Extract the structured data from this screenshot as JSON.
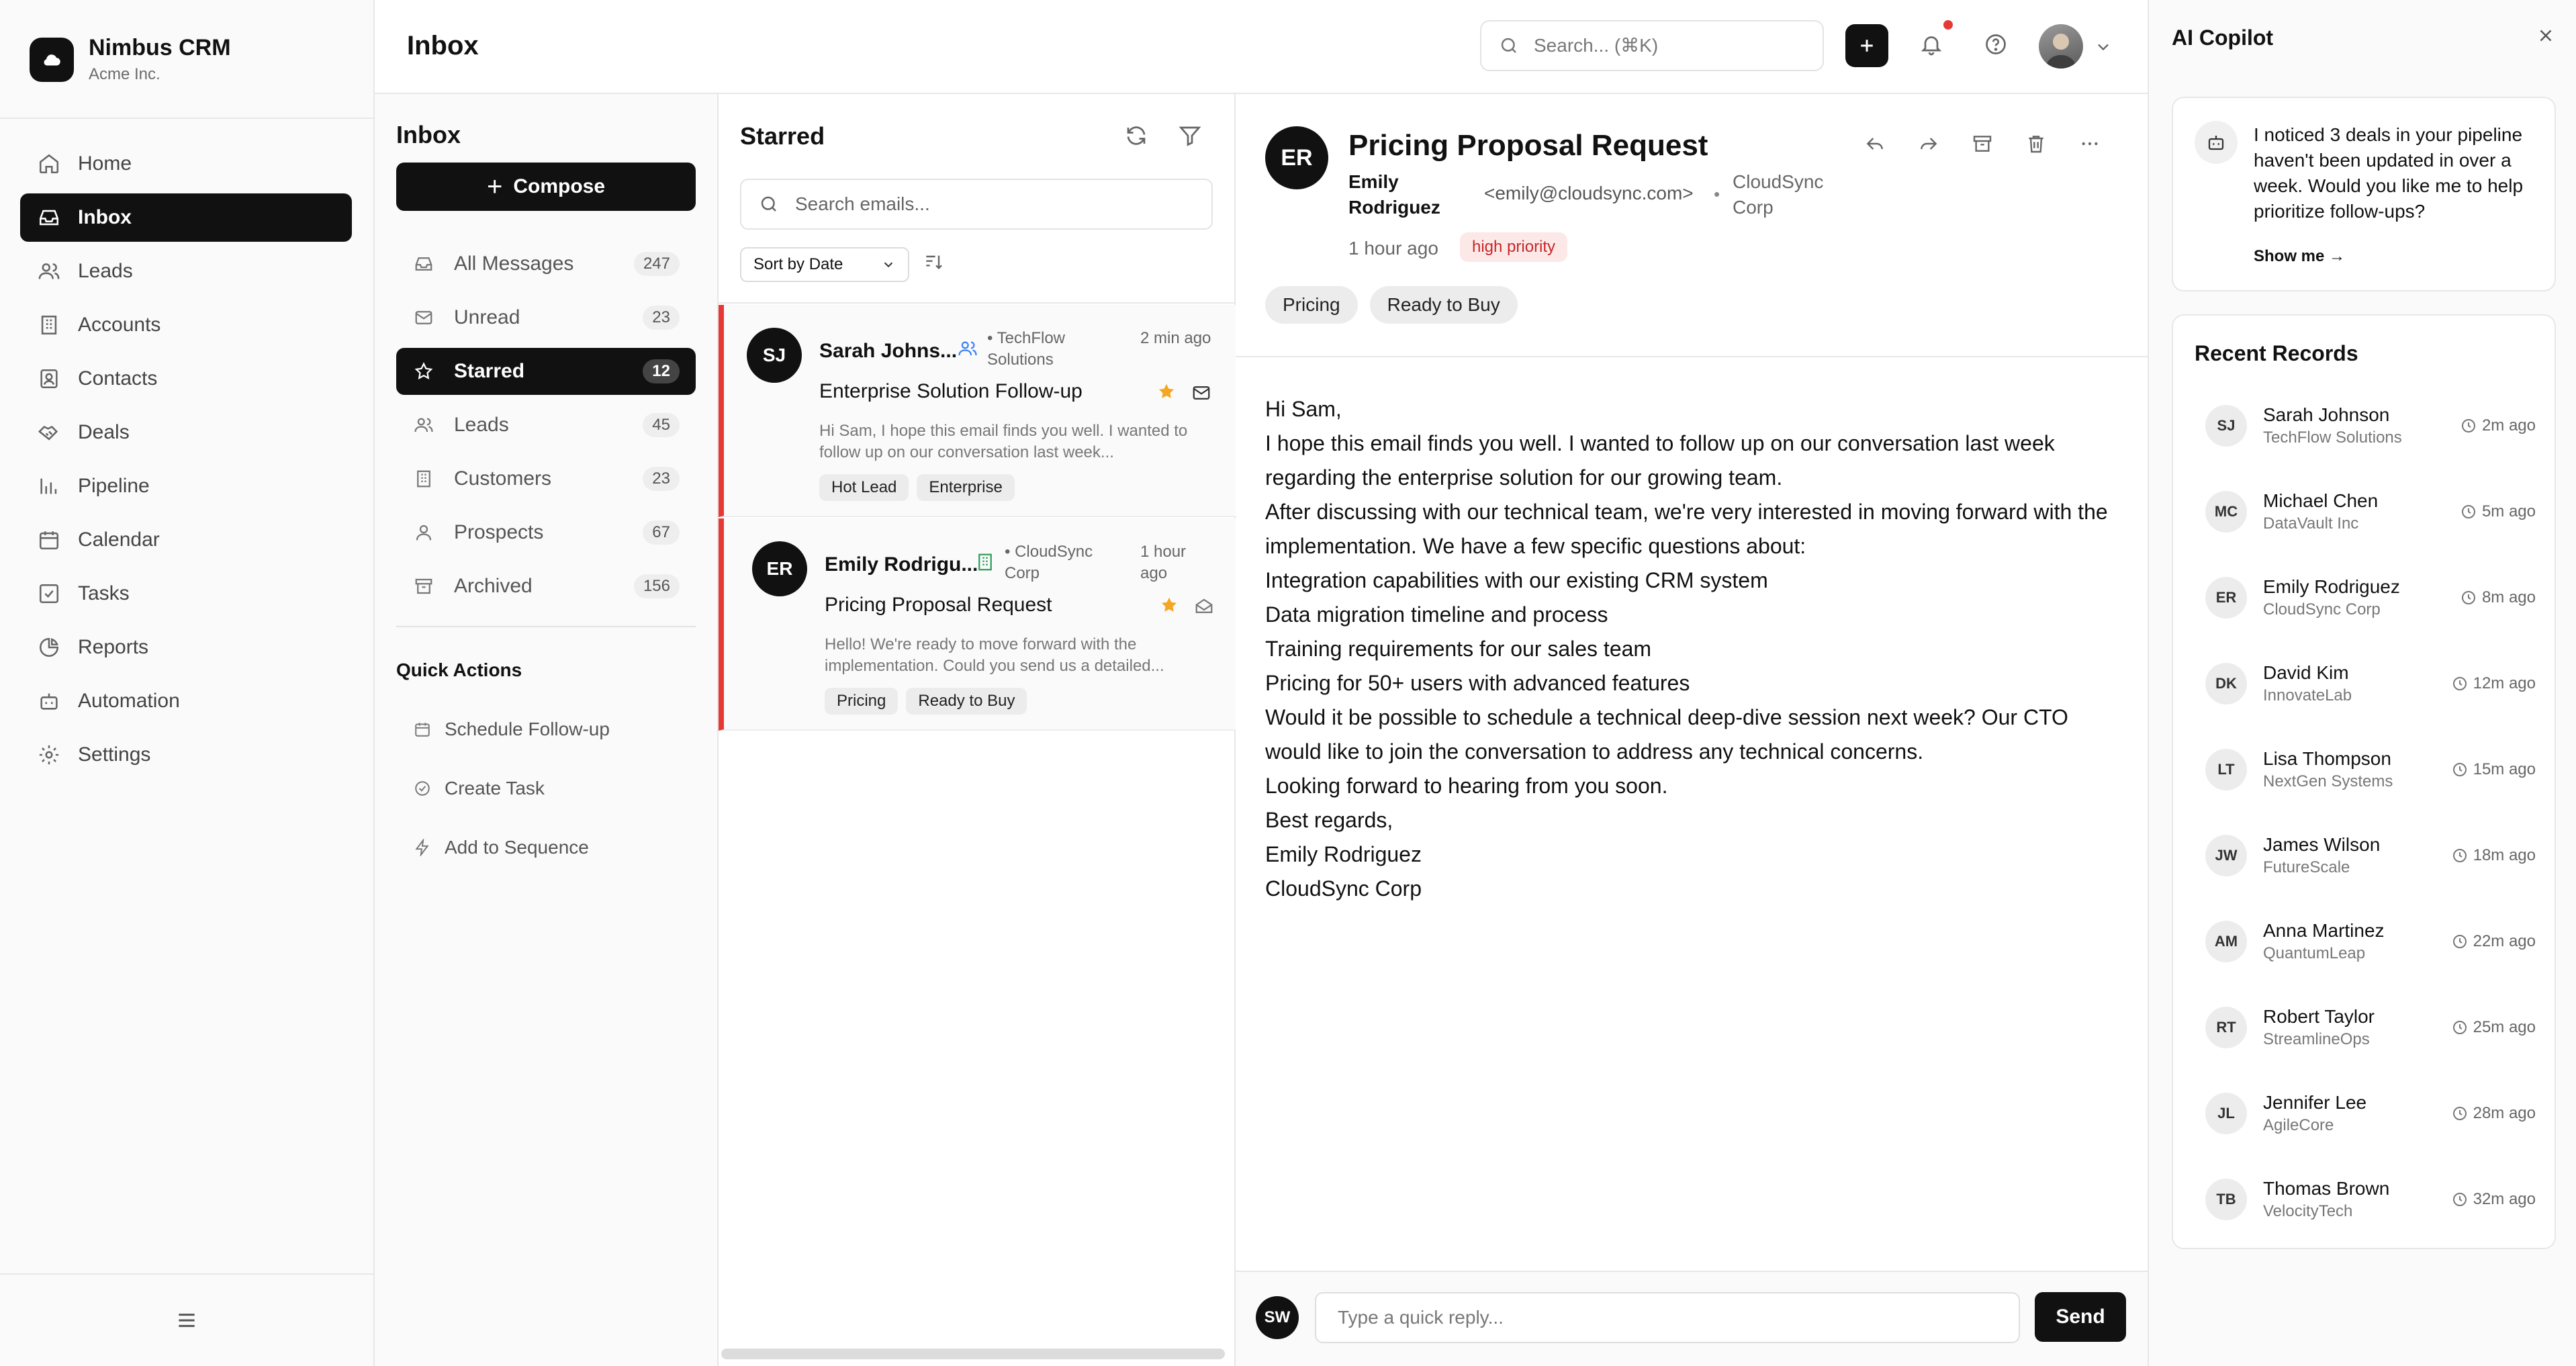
{
  "app": {
    "name": "Nimbus CRM",
    "org": "Acme Inc."
  },
  "nav": {
    "items": [
      {
        "label": "Home",
        "icon": "home-icon"
      },
      {
        "label": "Inbox",
        "icon": "inbox-icon",
        "active": true
      },
      {
        "label": "Leads",
        "icon": "users-icon"
      },
      {
        "label": "Accounts",
        "icon": "building-icon"
      },
      {
        "label": "Contacts",
        "icon": "contacts-icon"
      },
      {
        "label": "Deals",
        "icon": "handshake-icon"
      },
      {
        "label": "Pipeline",
        "icon": "bar-chart-icon"
      },
      {
        "label": "Calendar",
        "icon": "calendar-icon"
      },
      {
        "label": "Tasks",
        "icon": "checkbox-icon"
      },
      {
        "label": "Reports",
        "icon": "pie-chart-icon"
      },
      {
        "label": "Automation",
        "icon": "bot-icon"
      },
      {
        "label": "Settings",
        "icon": "gear-icon"
      }
    ]
  },
  "topbar": {
    "title": "Inbox",
    "search_placeholder": "Search... (⌘K)"
  },
  "folders": {
    "title": "Inbox",
    "compose_label": "Compose",
    "items": [
      {
        "label": "All Messages",
        "count": "247",
        "icon": "inbox-icon"
      },
      {
        "label": "Unread",
        "count": "23",
        "icon": "mail-icon"
      },
      {
        "label": "Starred",
        "count": "12",
        "icon": "star-icon",
        "active": true
      },
      {
        "label": "Leads",
        "count": "45",
        "icon": "users-icon"
      },
      {
        "label": "Customers",
        "count": "23",
        "icon": "building-icon"
      },
      {
        "label": "Prospects",
        "count": "67",
        "icon": "user-icon"
      },
      {
        "label": "Archived",
        "count": "156",
        "icon": "archive-icon"
      }
    ],
    "quick_actions_title": "Quick Actions",
    "quick_actions": [
      {
        "label": "Schedule Follow-up",
        "icon": "calendar-icon"
      },
      {
        "label": "Create Task",
        "icon": "check-circle-icon"
      },
      {
        "label": "Add to Sequence",
        "icon": "lightning-icon"
      }
    ]
  },
  "email_list": {
    "title": "Starred",
    "search_placeholder": "Search emails...",
    "sort_label": "Sort by Date",
    "emails": [
      {
        "initials": "SJ",
        "sender": "Sarah Johns...",
        "company": "• TechFlow Solutions",
        "time": "2 min ago",
        "subject": "Enterprise Solution Follow-up",
        "preview": "Hi Sam, I hope this email finds you well. I wanted to follow up on our conversation last week...",
        "tags": [
          "Hot Lead",
          "Enterprise"
        ]
      },
      {
        "initials": "ER",
        "sender": "Emily Rodrigu...",
        "company": "• CloudSync Corp",
        "time": "1 hour ago",
        "subject": "Pricing Proposal Request",
        "preview": "Hello! We're ready to move forward with the implementation. Could you send us a detailed...",
        "tags": [
          "Pricing",
          "Ready to Buy"
        ]
      }
    ]
  },
  "reader": {
    "initials": "ER",
    "subject": "Pricing Proposal Request",
    "from_name": "Emily Rodriguez",
    "from_email": "<emily@cloudsync.com>",
    "dot": "•",
    "company": "CloudSync Corp",
    "time": "1 hour ago",
    "priority": "high priority",
    "tags": [
      "Pricing",
      "Ready to Buy"
    ],
    "body": [
      "Hi Sam,",
      "I hope this email finds you well. I wanted to follow up on our conversation last week regarding the enterprise solution for our growing team.",
      "After discussing with our technical team, we're very interested in moving forward with the implementation. We have a few specific questions about:",
      "Integration capabilities with our existing CRM system",
      "Data migration timeline and process",
      "Training requirements for our sales team",
      "Pricing for 50+ users with advanced features",
      "Would it be possible to schedule a technical deep-dive session next week? Our CTO would like to join the conversation to address any technical concerns.",
      "Looking forward to hearing from you soon.",
      "Best regards,",
      "Emily Rodriguez",
      "CloudSync Corp"
    ],
    "reply_initials": "SW",
    "reply_placeholder": "Type a quick reply...",
    "send_label": "Send"
  },
  "copilot": {
    "title": "AI Copilot",
    "message": "I noticed 3 deals in your pipeline haven't been updated in over a week. Would you like me to help prioritize follow-ups?",
    "show_label": "Show me →",
    "recent_title": "Recent Records",
    "records": [
      {
        "initials": "SJ",
        "name": "Sarah Johnson",
        "org": "TechFlow Solutions",
        "time": "2m ago"
      },
      {
        "initials": "MC",
        "name": "Michael Chen",
        "org": "DataVault Inc",
        "time": "5m ago"
      },
      {
        "initials": "ER",
        "name": "Emily Rodriguez",
        "org": "CloudSync Corp",
        "time": "8m ago"
      },
      {
        "initials": "DK",
        "name": "David Kim",
        "org": "InnovateLab",
        "time": "12m ago"
      },
      {
        "initials": "LT",
        "name": "Lisa Thompson",
        "org": "NextGen Systems",
        "time": "15m ago"
      },
      {
        "initials": "JW",
        "name": "James Wilson",
        "org": "FutureScale",
        "time": "18m ago"
      },
      {
        "initials": "AM",
        "name": "Anna Martinez",
        "org": "QuantumLeap",
        "time": "22m ago"
      },
      {
        "initials": "RT",
        "name": "Robert Taylor",
        "org": "StreamlineOps",
        "time": "25m ago"
      },
      {
        "initials": "JL",
        "name": "Jennifer Lee",
        "org": "AgileCore",
        "time": "28m ago"
      },
      {
        "initials": "TB",
        "name": "Thomas Brown",
        "org": "VelocityTech",
        "time": "32m ago"
      }
    ]
  },
  "colors": {
    "accent": "#111111",
    "priority_bg": "#fde8e8",
    "priority_text": "#c62828",
    "unread_bar": "#e53935",
    "star": "#f5a623"
  }
}
